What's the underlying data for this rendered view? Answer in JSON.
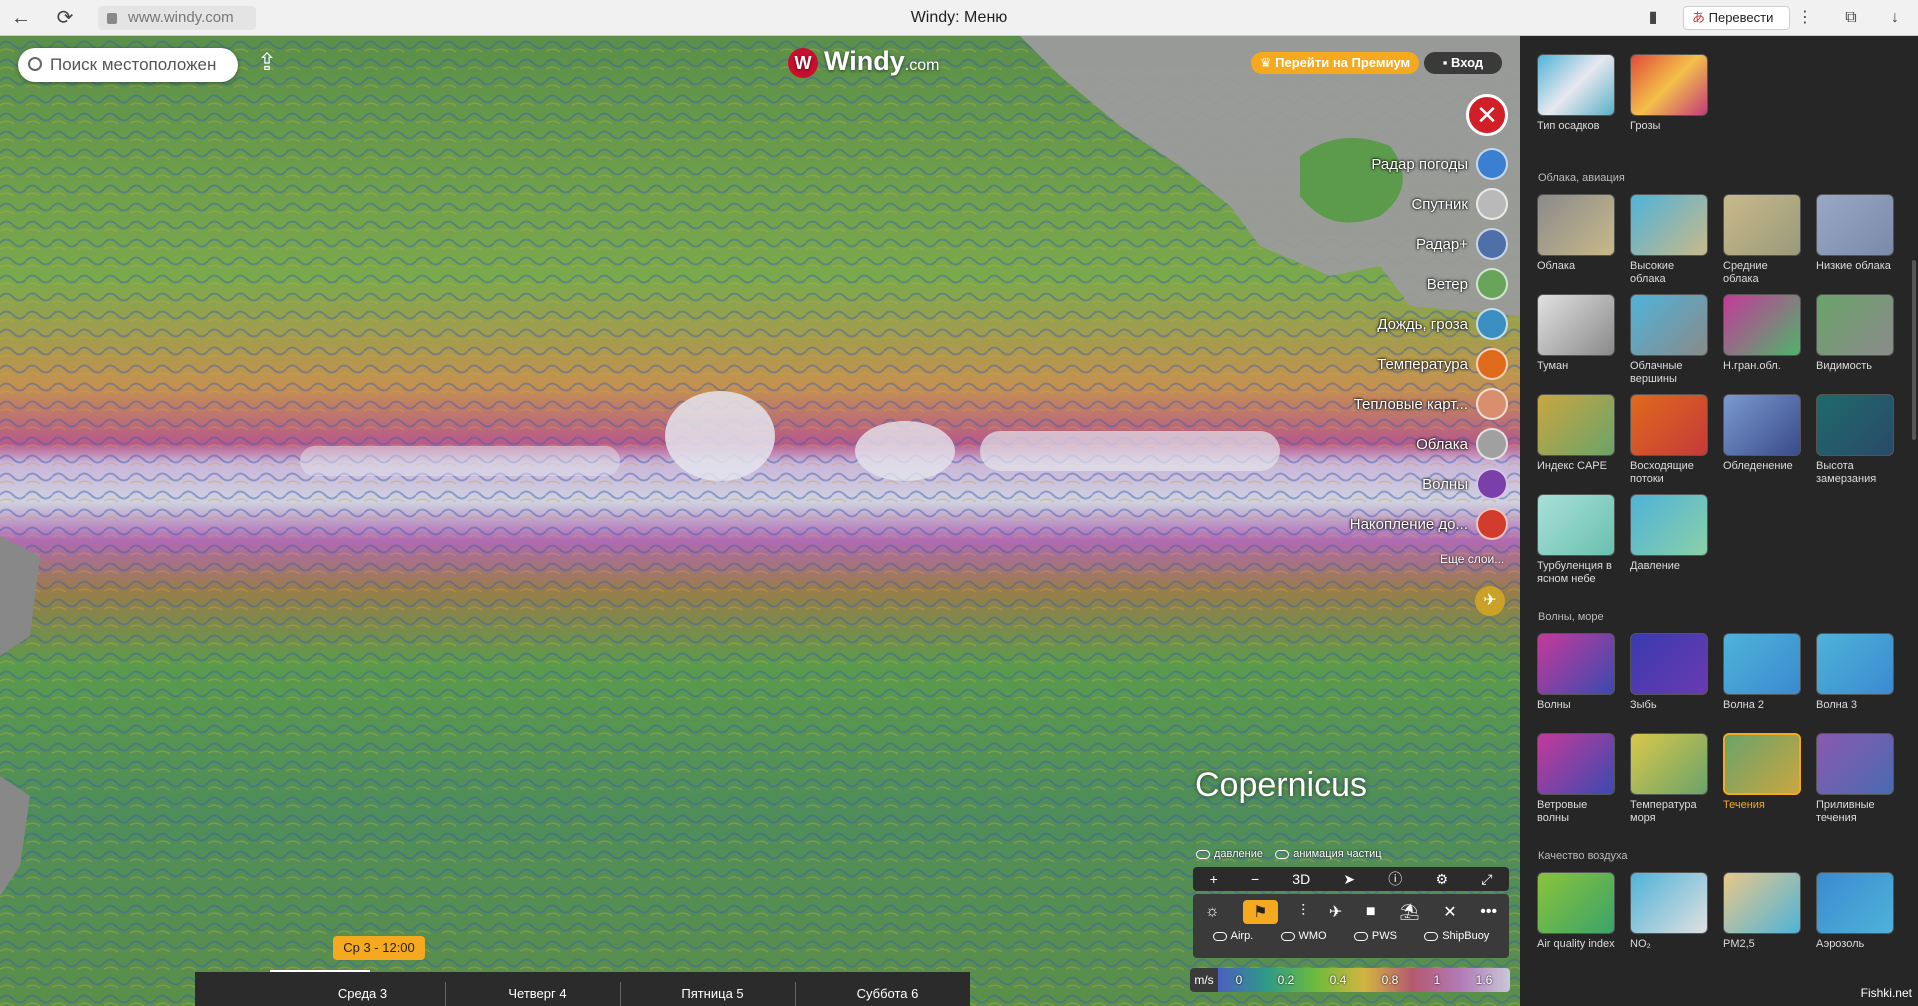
{
  "browser": {
    "url": "www.windy.com",
    "title": "Windy: Меню",
    "translate": "Перевести"
  },
  "map": {
    "search_placeholder": "Поиск местоположен",
    "logo": "Windy",
    "logo_suffix": ".com",
    "premium": "Перейти на Премиум",
    "login": "Вход",
    "more_layers": "Еще слои...",
    "copernicus": "Copernicus",
    "layers": [
      "Радар погоды",
      "Спутник",
      "Радар+",
      "Ветер",
      "Дождь, гроза",
      "Температура",
      "Тепловые карт...",
      "Облака",
      "Волны",
      "Накопление до..."
    ],
    "toggles": {
      "pressure": "давление",
      "particles": "анимация частиц",
      "airp": "Airp.",
      "wmo": "WMO",
      "pws": "PWS",
      "shipbuoy": "ShipBuoy"
    },
    "toolbar": {
      "zoom_in": "+",
      "zoom_out": "−",
      "three_d": "3D"
    },
    "legend": {
      "unit": "m/s",
      "values": [
        "0",
        "0.2",
        "0.4",
        "0.8",
        "1",
        "1.6"
      ]
    },
    "timeline": {
      "marker": "Ср 3 - 12:00",
      "days": [
        "Среда 3",
        "Четверг 4",
        "Пятница 5",
        "Суббота 6"
      ]
    },
    "colors": {
      "accent": "#f4a91f",
      "close": "#d01f26",
      "brand": "#c8102e"
    }
  },
  "panel": {
    "top_tiles": [
      "Тип осадков",
      "Грозы"
    ],
    "sections": [
      {
        "title": "Облака, авиация",
        "tiles": [
          "Облака",
          "Высокие облака",
          "Средние облака",
          "Низкие облака",
          "Туман",
          "Облачные вершины",
          "Н.гран.обл.",
          "Видимость",
          "Индекс CAPE",
          "Восходящие потоки",
          "Обледенение",
          "Высота замерзания",
          "Турбуленция в ясном небе",
          "Давление"
        ]
      },
      {
        "title": "Волны, море",
        "tiles": [
          "Волны",
          "Зыбь",
          "Волна 2",
          "Волна 3",
          "Ветровые волны",
          "Температура моря",
          "Течения",
          "Приливные течения"
        ]
      },
      {
        "title": "Качество воздуха",
        "tiles": [
          "Air quality index",
          "NO₂",
          "PM2,5",
          "Аэрозоль"
        ]
      }
    ],
    "selected": "Течения"
  },
  "watermark": "Fishki.net"
}
